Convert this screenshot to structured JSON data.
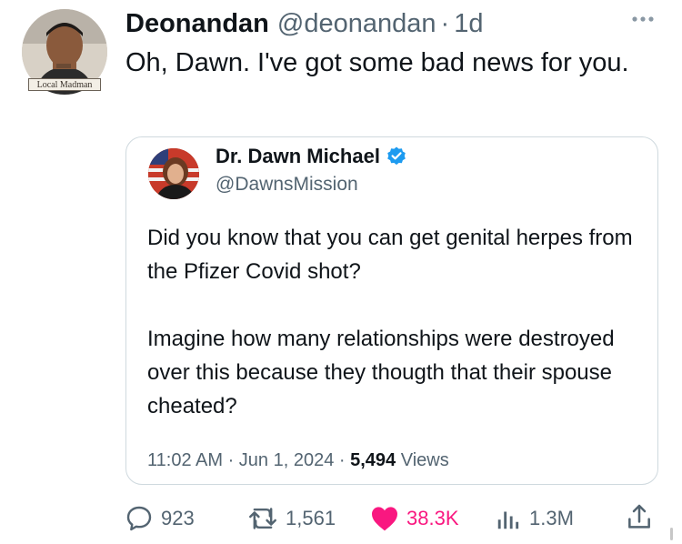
{
  "tweet": {
    "author_name": "Deonandan",
    "author_handle": "@deonandan",
    "separator": "·",
    "time_ago": "1d",
    "avatar_badge": "Local Madman",
    "text": "Oh, Dawn. I've got some bad news for you."
  },
  "quote": {
    "author_name": "Dr. Dawn Michael",
    "author_handle": "@DawnsMission",
    "paragraph_1": "Did you know that you can get genital herpes from the Pfizer Covid shot?",
    "paragraph_2": "Imagine how many relationships were destroyed over this because they thougth that their spouse cheated?",
    "meta_time": "11:02 AM · Jun 1, 2024 · ",
    "views_count": "5,494",
    "views_label": " Views"
  },
  "actions": {
    "replies": "923",
    "reposts": "1,561",
    "likes": "38.3K",
    "views": "1.3M"
  },
  "colors": {
    "like": "#f91880",
    "verified": "#1d9bf0",
    "secondary_text": "#536471"
  },
  "icons": [
    "more-icon",
    "verified-icon",
    "reply-icon",
    "repost-icon",
    "like-icon",
    "views-icon",
    "share-icon"
  ]
}
